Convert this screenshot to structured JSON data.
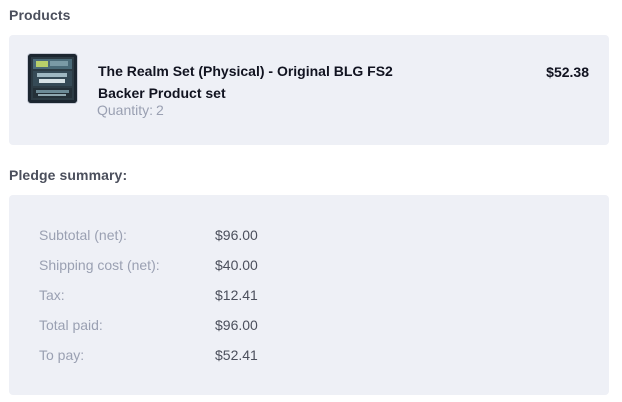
{
  "products": {
    "title": "Products",
    "items": [
      {
        "name": "The Realm Set (Physical) - Original BLG FS2 Backer Product set",
        "quantity_label": "Quantity:",
        "quantity": "2",
        "price": "$52.38",
        "image_icon": "product-box-image"
      }
    ]
  },
  "summary": {
    "title": "Pledge summary:",
    "rows": [
      {
        "label": "Subtotal (net):",
        "value": "$96.00"
      },
      {
        "label": "Shipping cost (net):",
        "value": "$40.00"
      },
      {
        "label": "Tax:",
        "value": "$12.41"
      },
      {
        "label": "Total paid:",
        "value": "$96.00"
      },
      {
        "label": "To pay:",
        "value": "$52.41"
      }
    ]
  },
  "colors": {
    "panel_background": "#eef0f6",
    "heading_text": "#4b4f5c",
    "muted_text": "#9aa0b2",
    "strong_text": "#111320"
  }
}
